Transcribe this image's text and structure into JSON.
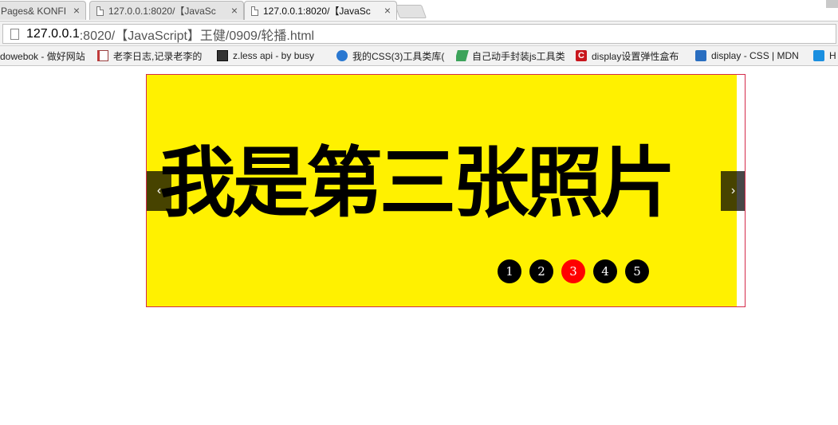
{
  "browser": {
    "tabs": [
      {
        "title": "Pages& KONFI",
        "close": "×",
        "active": false
      },
      {
        "title": "127.0.0.1:8020/【JavaSc",
        "close": "×",
        "active": false
      },
      {
        "title": "127.0.0.1:8020/【JavaSc",
        "close": "×",
        "active": true
      }
    ],
    "address": {
      "host": "127.0.0.1",
      "rest": ":8020/【JavaScript】王健/0909/轮播.html"
    },
    "bookmarks": [
      {
        "label": "dowebok - 做好网站",
        "icon": "page-icon"
      },
      {
        "label": "老李日志,记录老李的",
        "icon": "book-icon"
      },
      {
        "label": "z.less api - by busy",
        "icon": "zless-icon"
      },
      {
        "label": "我的CSS(3)工具类库(",
        "icon": "css-icon"
      },
      {
        "label": "自己动手封装js工具类",
        "icon": "tool-icon"
      },
      {
        "label": "display设置弹性盒布",
        "icon": "c-icon"
      },
      {
        "label": "display - CSS | MDN",
        "icon": "mdn-icon"
      },
      {
        "label": "H",
        "icon": "wifi-icon"
      }
    ]
  },
  "carousel": {
    "slide_text": "我是第三张照片",
    "prev_label": "‹",
    "next_label": "›",
    "dots": [
      "1",
      "2",
      "3",
      "4",
      "5"
    ],
    "active_dot": "3"
  },
  "colors": {
    "slide_background": "#fff100",
    "carousel_border": "#d42b4b",
    "dot_active": "#ff0000",
    "dot_default": "#000000"
  }
}
